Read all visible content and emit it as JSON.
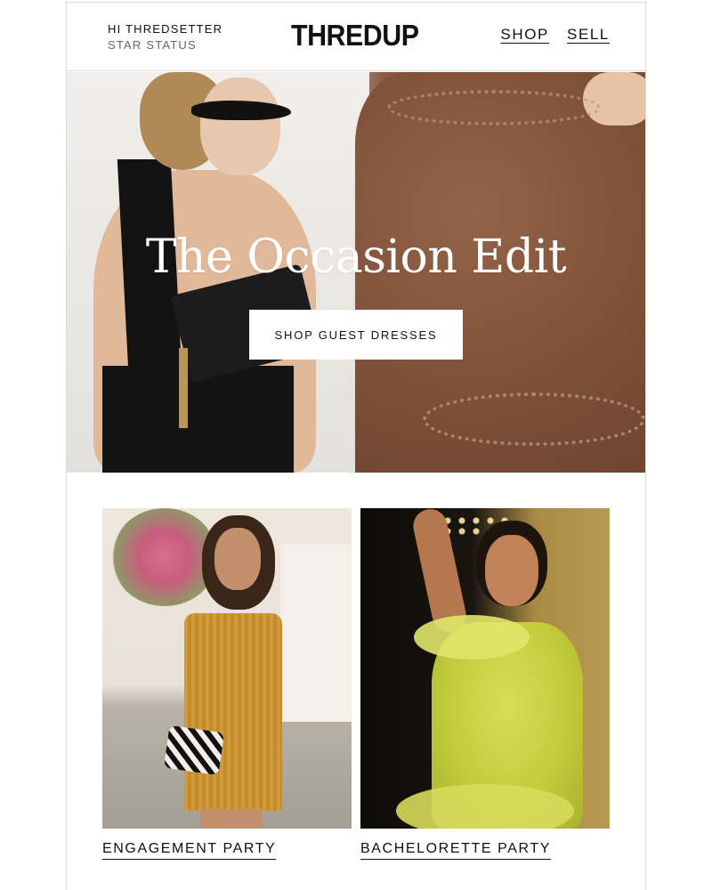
{
  "header": {
    "greeting": "HI THREDSETTER",
    "status": "STAR STATUS",
    "logo": "THREDUP",
    "nav": [
      {
        "label": "SHOP"
      },
      {
        "label": "SELL"
      }
    ]
  },
  "hero": {
    "title": "The Occasion Edit",
    "button_label": "SHOP GUEST DRESSES"
  },
  "tiles": [
    {
      "label": "ENGAGEMENT PARTY"
    },
    {
      "label": "BACHELORETTE PARTY"
    }
  ],
  "colors": {
    "text": "#111111",
    "border": "#dcdcdc",
    "hero_title": "#ffffff",
    "button_bg": "#ffffff"
  }
}
